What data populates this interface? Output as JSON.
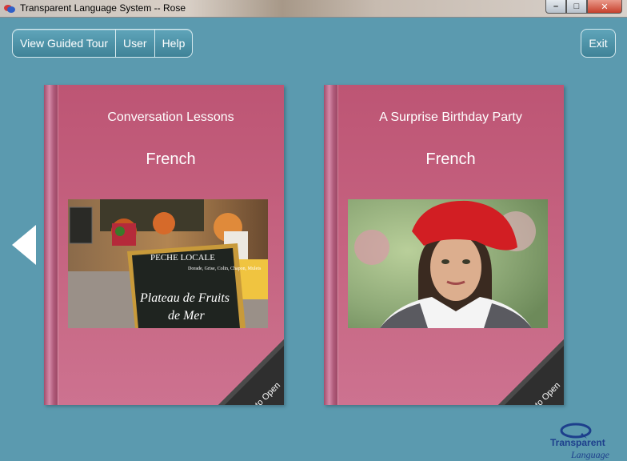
{
  "window": {
    "title": "Transparent Language System -- Rose",
    "controls": {
      "minimize": "–",
      "maximize": "□",
      "close": "✕"
    }
  },
  "toolbar": {
    "guided_tour": "View Guided Tour",
    "user": "User",
    "help": "Help",
    "exit": "Exit"
  },
  "books": [
    {
      "title": "Conversation Lessons",
      "language": "French",
      "photo_icon": "french-cafe-chalkboard-photo",
      "photo_text": {
        "line1": "PECHE LOCALE",
        "line2": "Dorade, Grise, Colin, Chapon, Mulets",
        "line3": "Plateau de Fruits",
        "line4": "de Mer"
      },
      "corner_label": "Click to Open"
    },
    {
      "title": "A Surprise Birthday Party",
      "language": "French",
      "photo_icon": "woman-red-beret-photo",
      "corner_label": "Click to Open"
    }
  ],
  "logo": {
    "line1": "Transparent",
    "line2": "Language"
  },
  "colors": {
    "background": "#5b9aaf",
    "book": "#c4607e",
    "spine": "#a24d6c",
    "corner": "#2f2f2f",
    "logo": "#1d3f8c"
  },
  "icons": {
    "prev": "left-arrow-icon"
  }
}
